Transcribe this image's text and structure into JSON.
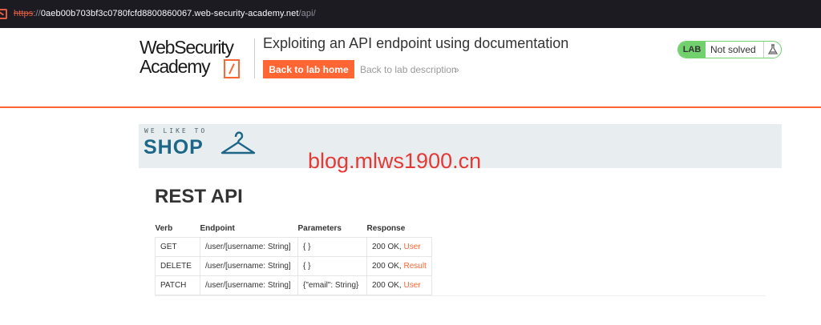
{
  "browser": {
    "url_scheme": "https",
    "url_sep": "://",
    "url_host": "0aeb00b703bf3c0780fcfd8800860067.web-security-academy.net",
    "url_path": "/api/"
  },
  "header": {
    "logo_line1": "WebSecurity",
    "logo_line2": "Academy",
    "lab_title": "Exploiting an API endpoint using documentation",
    "back_home_label": "Back to lab home",
    "back_desc_label": "Back to lab description",
    "chevron": "»",
    "lab_badge": "LAB",
    "lab_status": "Not solved"
  },
  "shop": {
    "tagline": "WE LIKE TO",
    "name": "SHOP"
  },
  "watermark": "blog.mlws1900.cn",
  "main": {
    "heading": "REST API",
    "table": {
      "headers": [
        "Verb",
        "Endpoint",
        "Parameters",
        "Response"
      ],
      "rows": [
        {
          "verb": "GET",
          "endpoint": "/user/[username: String]",
          "params": "{ }",
          "response": "200 OK,",
          "link": "User"
        },
        {
          "verb": "DELETE",
          "endpoint": "/user/[username: String]",
          "params": "{ }",
          "response": "200 OK,",
          "link": "Result"
        },
        {
          "verb": "PATCH",
          "endpoint": "/user/[username: String]",
          "params": "{\"email\": String}",
          "response": "200 OK,",
          "link": "User"
        }
      ]
    }
  },
  "colors": {
    "accent": "#ff6633",
    "lab_green": "#70d16d",
    "shop_blue": "#1d6688"
  }
}
